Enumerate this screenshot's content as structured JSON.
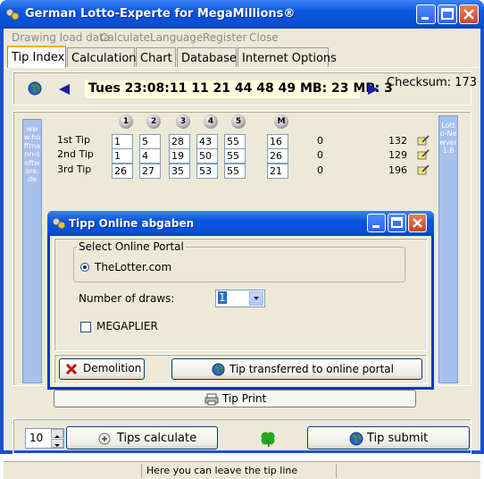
{
  "window": {
    "title": "German Lotto-Experte for MegaMillions®"
  },
  "menu": [
    "Drawing load data",
    "Calculate",
    "Language",
    "Register",
    "Close"
  ],
  "tabs": [
    "Tip Index",
    "Calculation",
    "Chart",
    "Database",
    "Internet Options"
  ],
  "draw": {
    "text": "Tues 23:08:11 11 21 44 48 49 MB: 23 MP: 3",
    "checksum": "Checksum: 173"
  },
  "left_strip_text": "www.hoffmann-software.de",
  "right_strip_text": "Lotto-Newver 1.8",
  "columns": [
    "1",
    "2",
    "3",
    "4",
    "5",
    "M"
  ],
  "tips": [
    {
      "label": "1st Tip",
      "numbers": [
        "1",
        "5",
        "28",
        "43",
        "55"
      ],
      "mega": "16",
      "hits": "0",
      "sum": "132"
    },
    {
      "label": "2nd Tip",
      "numbers": [
        "1",
        "4",
        "19",
        "50",
        "55"
      ],
      "mega": "26",
      "hits": "0",
      "sum": "129"
    },
    {
      "label": "3rd Tip",
      "numbers": [
        "26",
        "27",
        "35",
        "53",
        "55"
      ],
      "mega": "21",
      "hits": "0",
      "sum": "196"
    }
  ],
  "print_label": "Tip Print",
  "bottom": {
    "count": "10",
    "calc_label": "Tips calculate",
    "submit_label": "Tip submit"
  },
  "status": "Here you can leave the tip line",
  "dialog": {
    "title": "Tipp Online abgaben",
    "group_label": "Select Online Portal",
    "portal": "TheLotter.com",
    "draws_label": "Number of draws:",
    "draws_value": "1",
    "megaplier_label": "MEGAPLIER",
    "demolition_label": "Demolition",
    "transfer_label": "Tip transferred to online portal"
  }
}
